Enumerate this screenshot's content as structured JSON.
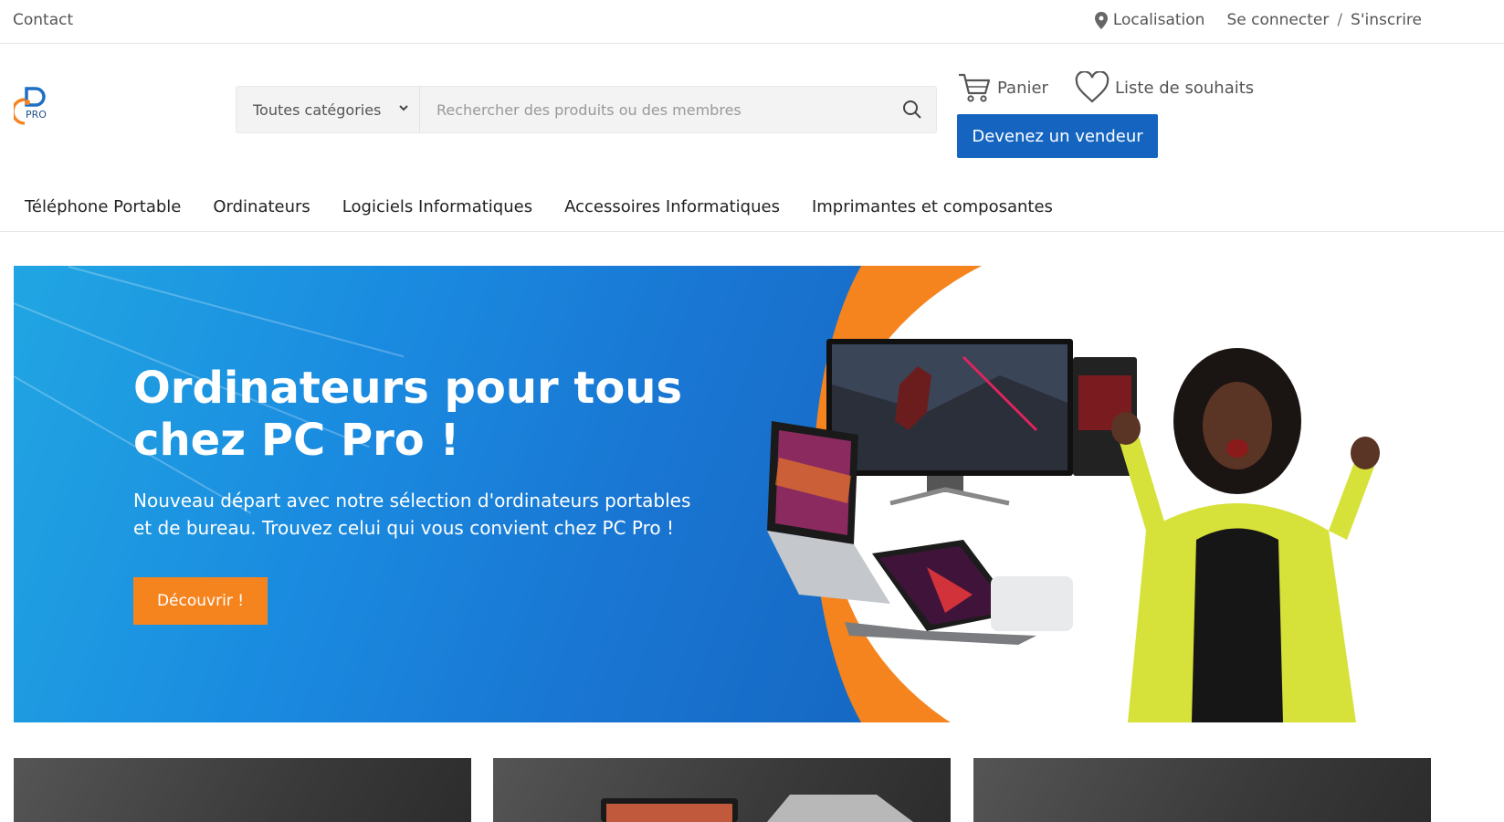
{
  "topbar": {
    "contact": "Contact",
    "location": "Localisation",
    "login": "Se connecter",
    "separator": "/",
    "register": "S'inscrire"
  },
  "header": {
    "logo_text": "PRO",
    "search": {
      "category": "Toutes catégories",
      "placeholder": "Rechercher des produits ou des membres"
    },
    "cart_label": "Panier",
    "wishlist_label": "Liste de souhaits",
    "vendor_button": "Devenez un vendeur"
  },
  "nav": {
    "items": [
      {
        "label": "Téléphone Portable"
      },
      {
        "label": "Ordinateurs"
      },
      {
        "label": "Logiciels Informatiques"
      },
      {
        "label": "Accessoires Informatiques"
      },
      {
        "label": "Imprimantes et composantes"
      }
    ]
  },
  "hero": {
    "title_line1": "Ordinateurs pour tous",
    "title_line2": "chez PC Pro !",
    "text_line1": "Nouveau départ avec notre sélection d'ordinateurs portables",
    "text_line2": "et de bureau. Trouvez celui qui vous convient chez PC Pro !",
    "cta": "Découvrir !"
  },
  "colors": {
    "brand_blue": "#1565c0",
    "accent_orange": "#f5841f"
  }
}
